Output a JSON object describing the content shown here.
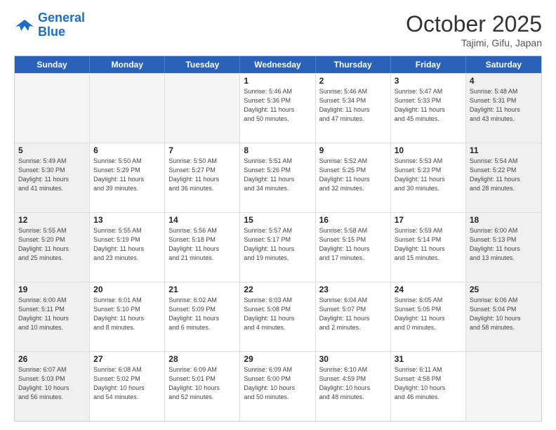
{
  "logo": {
    "line1": "General",
    "line2": "Blue"
  },
  "title": "October 2025",
  "subtitle": "Tajimi, Gifu, Japan",
  "days": [
    "Sunday",
    "Monday",
    "Tuesday",
    "Wednesday",
    "Thursday",
    "Friday",
    "Saturday"
  ],
  "rows": [
    [
      {
        "day": "",
        "info": "",
        "empty": true
      },
      {
        "day": "",
        "info": "",
        "empty": true
      },
      {
        "day": "",
        "info": "",
        "empty": true
      },
      {
        "day": "1",
        "info": "Sunrise: 5:46 AM\nSunset: 5:36 PM\nDaylight: 11 hours\nand 50 minutes."
      },
      {
        "day": "2",
        "info": "Sunrise: 5:46 AM\nSunset: 5:34 PM\nDaylight: 11 hours\nand 47 minutes."
      },
      {
        "day": "3",
        "info": "Sunrise: 5:47 AM\nSunset: 5:33 PM\nDaylight: 11 hours\nand 45 minutes."
      },
      {
        "day": "4",
        "info": "Sunrise: 5:48 AM\nSunset: 5:31 PM\nDaylight: 11 hours\nand 43 minutes.",
        "shaded": true
      }
    ],
    [
      {
        "day": "5",
        "info": "Sunrise: 5:49 AM\nSunset: 5:30 PM\nDaylight: 11 hours\nand 41 minutes.",
        "shaded": true
      },
      {
        "day": "6",
        "info": "Sunrise: 5:50 AM\nSunset: 5:29 PM\nDaylight: 11 hours\nand 39 minutes."
      },
      {
        "day": "7",
        "info": "Sunrise: 5:50 AM\nSunset: 5:27 PM\nDaylight: 11 hours\nand 36 minutes."
      },
      {
        "day": "8",
        "info": "Sunrise: 5:51 AM\nSunset: 5:26 PM\nDaylight: 11 hours\nand 34 minutes."
      },
      {
        "day": "9",
        "info": "Sunrise: 5:52 AM\nSunset: 5:25 PM\nDaylight: 11 hours\nand 32 minutes."
      },
      {
        "day": "10",
        "info": "Sunrise: 5:53 AM\nSunset: 5:23 PM\nDaylight: 11 hours\nand 30 minutes."
      },
      {
        "day": "11",
        "info": "Sunrise: 5:54 AM\nSunset: 5:22 PM\nDaylight: 11 hours\nand 28 minutes.",
        "shaded": true
      }
    ],
    [
      {
        "day": "12",
        "info": "Sunrise: 5:55 AM\nSunset: 5:20 PM\nDaylight: 11 hours\nand 25 minutes.",
        "shaded": true
      },
      {
        "day": "13",
        "info": "Sunrise: 5:55 AM\nSunset: 5:19 PM\nDaylight: 11 hours\nand 23 minutes."
      },
      {
        "day": "14",
        "info": "Sunrise: 5:56 AM\nSunset: 5:18 PM\nDaylight: 11 hours\nand 21 minutes."
      },
      {
        "day": "15",
        "info": "Sunrise: 5:57 AM\nSunset: 5:17 PM\nDaylight: 11 hours\nand 19 minutes."
      },
      {
        "day": "16",
        "info": "Sunrise: 5:58 AM\nSunset: 5:15 PM\nDaylight: 11 hours\nand 17 minutes."
      },
      {
        "day": "17",
        "info": "Sunrise: 5:59 AM\nSunset: 5:14 PM\nDaylight: 11 hours\nand 15 minutes."
      },
      {
        "day": "18",
        "info": "Sunrise: 6:00 AM\nSunset: 5:13 PM\nDaylight: 11 hours\nand 13 minutes.",
        "shaded": true
      }
    ],
    [
      {
        "day": "19",
        "info": "Sunrise: 6:00 AM\nSunset: 5:11 PM\nDaylight: 11 hours\nand 10 minutes.",
        "shaded": true
      },
      {
        "day": "20",
        "info": "Sunrise: 6:01 AM\nSunset: 5:10 PM\nDaylight: 11 hours\nand 8 minutes."
      },
      {
        "day": "21",
        "info": "Sunrise: 6:02 AM\nSunset: 5:09 PM\nDaylight: 11 hours\nand 6 minutes."
      },
      {
        "day": "22",
        "info": "Sunrise: 6:03 AM\nSunset: 5:08 PM\nDaylight: 11 hours\nand 4 minutes."
      },
      {
        "day": "23",
        "info": "Sunrise: 6:04 AM\nSunset: 5:07 PM\nDaylight: 11 hours\nand 2 minutes."
      },
      {
        "day": "24",
        "info": "Sunrise: 6:05 AM\nSunset: 5:05 PM\nDaylight: 11 hours\nand 0 minutes."
      },
      {
        "day": "25",
        "info": "Sunrise: 6:06 AM\nSunset: 5:04 PM\nDaylight: 10 hours\nand 58 minutes.",
        "shaded": true
      }
    ],
    [
      {
        "day": "26",
        "info": "Sunrise: 6:07 AM\nSunset: 5:03 PM\nDaylight: 10 hours\nand 56 minutes.",
        "shaded": true
      },
      {
        "day": "27",
        "info": "Sunrise: 6:08 AM\nSunset: 5:02 PM\nDaylight: 10 hours\nand 54 minutes."
      },
      {
        "day": "28",
        "info": "Sunrise: 6:09 AM\nSunset: 5:01 PM\nDaylight: 10 hours\nand 52 minutes."
      },
      {
        "day": "29",
        "info": "Sunrise: 6:09 AM\nSunset: 5:00 PM\nDaylight: 10 hours\nand 50 minutes."
      },
      {
        "day": "30",
        "info": "Sunrise: 6:10 AM\nSunset: 4:59 PM\nDaylight: 10 hours\nand 48 minutes."
      },
      {
        "day": "31",
        "info": "Sunrise: 6:11 AM\nSunset: 4:58 PM\nDaylight: 10 hours\nand 46 minutes."
      },
      {
        "day": "",
        "info": "",
        "empty": true,
        "shaded": true
      }
    ]
  ]
}
